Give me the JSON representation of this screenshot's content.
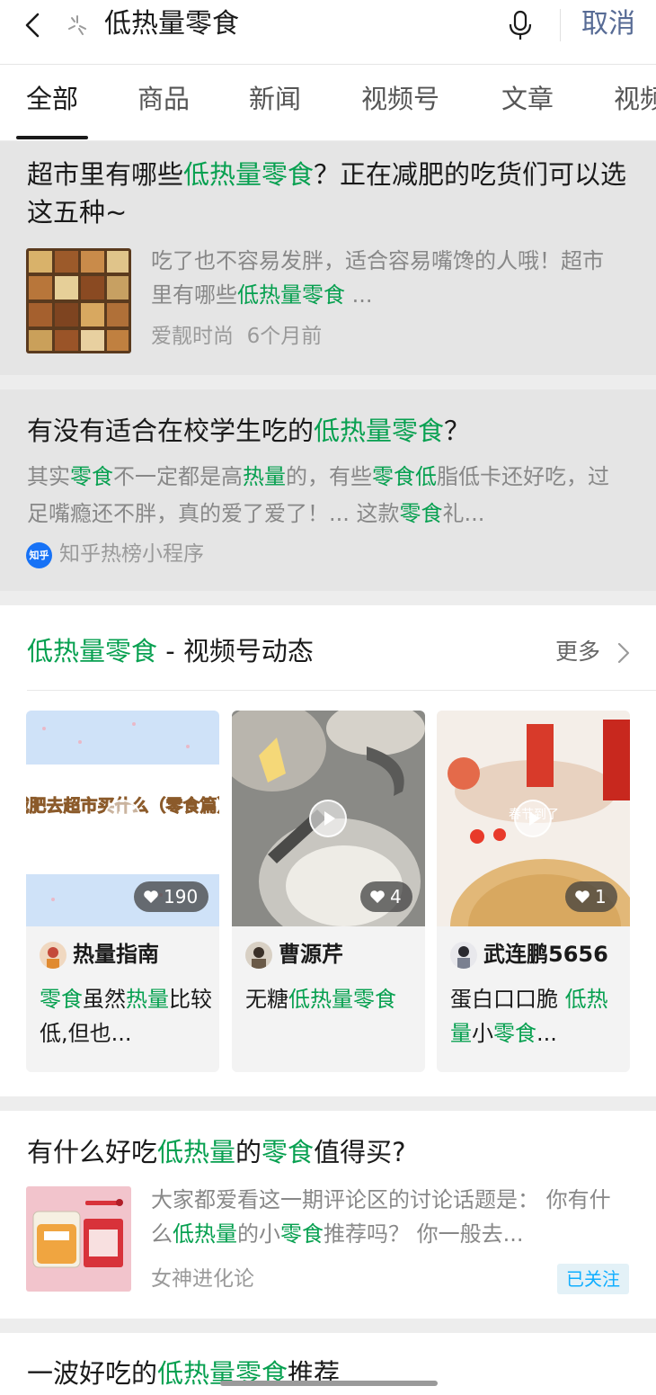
{
  "search": {
    "query": "低热量零食",
    "cancel_label": "取消"
  },
  "tabs": [
    {
      "label": "全部",
      "active": true
    },
    {
      "label": "商品"
    },
    {
      "label": "新闻"
    },
    {
      "label": "视频号"
    },
    {
      "label": "文章"
    },
    {
      "label": "视频"
    }
  ],
  "results": [
    {
      "title": [
        "超市里有哪些",
        "低热量零食",
        "？正在减肥的吃货们可以选这五种~"
      ],
      "summary": [
        "吃了也不容易发胖，适合容易嘴馋的人哦！超市里有哪些",
        "低热量零食",
        " ..."
      ],
      "source": "爱靓时尚",
      "time": "6个月前",
      "thumb_icon": "nuts-assortment-image"
    },
    {
      "title": [
        "有没有适合在校学生吃的",
        "低热量零食",
        "？"
      ],
      "desc": [
        "其实",
        "零食",
        "不一定都是高",
        "热量",
        "的，有些",
        "零食低",
        "脂低卡还好吃，过足嘴瘾还不胖，真的爱了爱了！... 这款",
        "零食",
        "礼..."
      ],
      "source_badge": "知乎",
      "source": "知乎热榜小程序"
    },
    {
      "title": [
        "有什么好吃",
        "低热量",
        "的",
        "零食",
        "值得买?"
      ],
      "summary": [
        "大家都爱看这一期评论区的讨论话题是： 你有什么",
        "低热量",
        "的小",
        "零食",
        "推荐吗？ 你一般去..."
      ],
      "source": "女神进化论",
      "follow_label": "已关注",
      "thumb_icon": "bread-snack-image"
    }
  ],
  "channels": {
    "heading_keyword": "低热量零食",
    "heading_rest": " - 视频号动态",
    "more_label": "更多",
    "items": [
      {
        "likes": "190",
        "author": "热量指南",
        "text": [
          "零食",
          "虽然",
          "热量",
          "比较低,但也..."
        ],
        "overlay_text": "减肥去超市买什么（零食篇）"
      },
      {
        "likes": "4",
        "author": "曹源芹",
        "text": [
          "无糖",
          "低热量零食"
        ]
      },
      {
        "likes": "1",
        "author": "武连鹏5656",
        "text": [
          "蛋白口口脆 ",
          "低热量",
          "小",
          "零食",
          "..."
        ],
        "overlay_text": "春节到了"
      }
    ]
  },
  "partial_next": [
    "一波好吃的",
    "低热量零食",
    "推荐"
  ],
  "colors": {
    "highlight": "#07a050",
    "link": "#576b95",
    "follow_text": "#10aeff"
  }
}
